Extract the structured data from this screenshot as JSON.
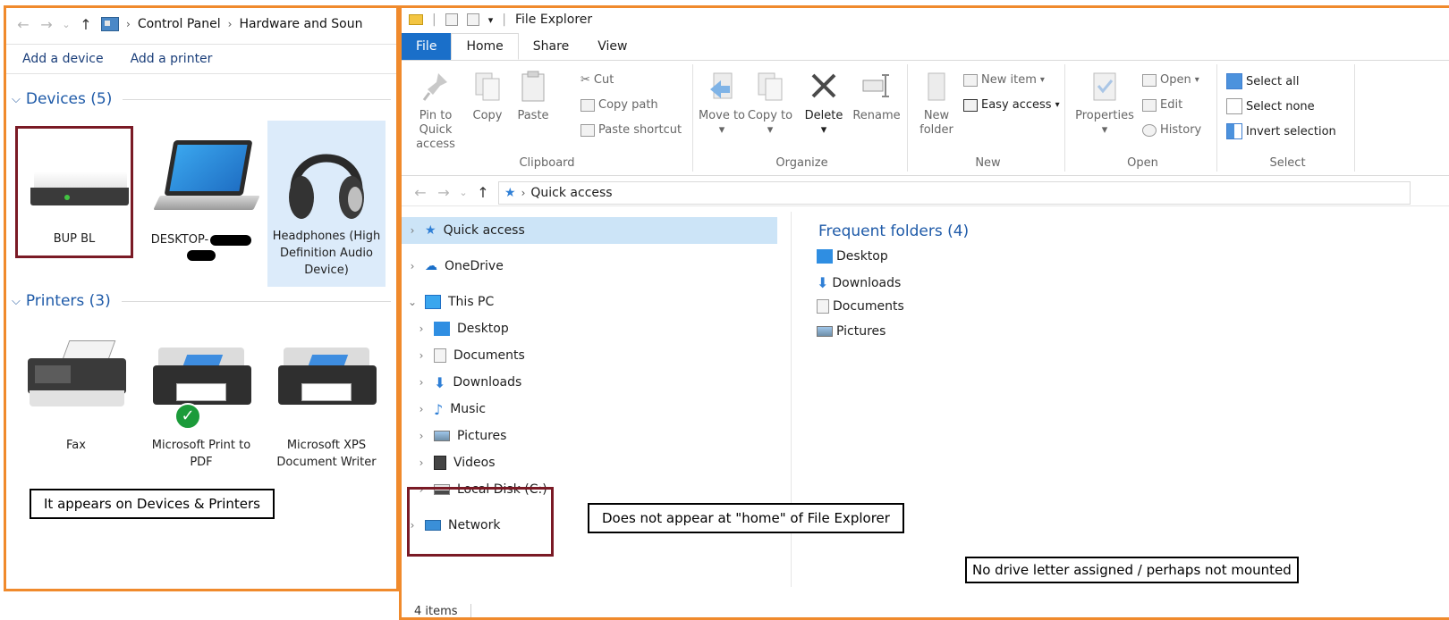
{
  "colors": {
    "annotation_border_orange": "#f08a2c",
    "highlight_box_maroon": "#7a1a25",
    "link_blue": "#1e5aa8",
    "file_tab_blue": "#1a6fc9",
    "selection_blue": "#cce4f7"
  },
  "devices_window": {
    "breadcrumb": [
      "Control Panel",
      "Hardware and Soun"
    ],
    "commands": {
      "add_device": "Add a device",
      "add_printer": "Add a printer"
    },
    "devices_group": "Devices (5)",
    "printers_group": "Printers (3)",
    "devices": [
      {
        "label": "BUP BL",
        "icon": "external-drive-icon"
      },
      {
        "label": "DESKTOP-",
        "icon": "laptop-icon"
      },
      {
        "label": "Headphones (High Definition Audio Device)",
        "icon": "headphones-icon"
      }
    ],
    "printers": [
      {
        "label": "Fax",
        "icon": "fax-icon"
      },
      {
        "label": "Microsoft Print to PDF",
        "icon": "printer-icon",
        "default": true
      },
      {
        "label": "Microsoft XPS Document Writer",
        "icon": "printer-icon"
      }
    ],
    "annotation": "It appears on Devices & Printers"
  },
  "explorer": {
    "title": "File Explorer",
    "tabs": {
      "file": "File",
      "home": "Home",
      "share": "Share",
      "view": "View"
    },
    "ribbon": {
      "clipboard": {
        "label": "Clipboard",
        "pin": "Pin to Quick access",
        "copy": "Copy",
        "paste": "Paste",
        "cut": "Cut",
        "copy_path": "Copy path",
        "paste_shortcut": "Paste shortcut"
      },
      "organize": {
        "label": "Organize",
        "move_to": "Move to",
        "copy_to": "Copy to",
        "delete": "Delete",
        "rename": "Rename"
      },
      "new": {
        "label": "New",
        "new_folder": "New folder",
        "new_item": "New item",
        "easy_access": "Easy access"
      },
      "open": {
        "label": "Open",
        "properties": "Properties",
        "open": "Open",
        "edit": "Edit",
        "history": "History"
      },
      "select": {
        "label": "Select",
        "select_all": "Select all",
        "select_none": "Select none",
        "invert": "Invert selection"
      }
    },
    "address": "Quick access",
    "nav": {
      "quick_access": "Quick access",
      "onedrive": "OneDrive",
      "this_pc": "This PC",
      "desktop": "Desktop",
      "documents": "Documents",
      "downloads": "Downloads",
      "music": "Music",
      "pictures": "Pictures",
      "videos": "Videos",
      "local_disk": "Local Disk (C:)",
      "network": "Network"
    },
    "frequent_head": "Frequent folders (4)",
    "frequent": [
      "Desktop",
      "Downloads",
      "Documents",
      "Pictures"
    ],
    "status": "4 items",
    "annotation_home": "Does not appear at \"home\" of File Explorer",
    "annotation_drive": "No drive letter assigned / perhaps not mounted"
  }
}
